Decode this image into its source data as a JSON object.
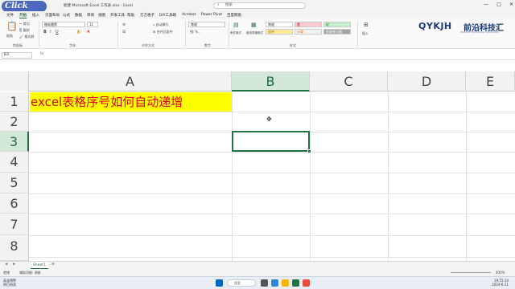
{
  "window": {
    "app_badge": "Click",
    "title": "新建 Microsoft Excel 工作表.xlsx - Excel",
    "search_placeholder": "搜索",
    "controls": [
      "—",
      "□",
      "✕"
    ]
  },
  "ribbon_tabs": [
    "文件",
    "开始",
    "插入",
    "页面布局",
    "公式",
    "数据",
    "审阅",
    "视图",
    "开发工具",
    "帮助",
    "方方格子",
    "DIY工具箱",
    "Acrobat",
    "Power Pivot",
    "百度网盘"
  ],
  "ribbon": {
    "clipboard": {
      "label": "剪贴板",
      "paste": "粘贴",
      "cut": "剪切",
      "copy": "复制",
      "format_painter": "格式刷"
    },
    "font": {
      "label": "字体",
      "font_name": "微软雅黑",
      "font_size": "11"
    },
    "alignment": {
      "label": "对齐方式",
      "wrap": "自动换行",
      "merge": "合并后居中"
    },
    "number": {
      "label": "数字",
      "format": "常规"
    },
    "styles": {
      "label": "样式",
      "conditional": "条件格式",
      "as_table": "套用表格格式",
      "cells": [
        "常规",
        "差",
        "好",
        "适中",
        "计算",
        "检查单元格"
      ]
    },
    "insert": "插入"
  },
  "brand": {
    "name": "QYKJH",
    "chinese": "前沿科技汇",
    "tagline": "FRONTIER TECHNOLOGY COLLECTION"
  },
  "formula_bar": {
    "name_box": "B3",
    "fx": "fx",
    "content": ""
  },
  "columns": [
    "A",
    "B",
    "C",
    "D",
    "E"
  ],
  "rows": [
    "1",
    "2",
    "3",
    "4",
    "5",
    "6",
    "7",
    "8"
  ],
  "cells": {
    "A1": "excel表格序号如何自动递增"
  },
  "selected": {
    "col": "B",
    "row": "3"
  },
  "sheet_tabs": [
    "Sheet1"
  ],
  "status": {
    "ready": "就绪",
    "accessibility": "辅助功能: 调查",
    "zoom": "400%"
  },
  "taskbar": {
    "weather_temp": "高温预警",
    "weather_note": "明日热浪",
    "search": "搜索",
    "time": "19:15:10",
    "date": "2024-6-11"
  }
}
